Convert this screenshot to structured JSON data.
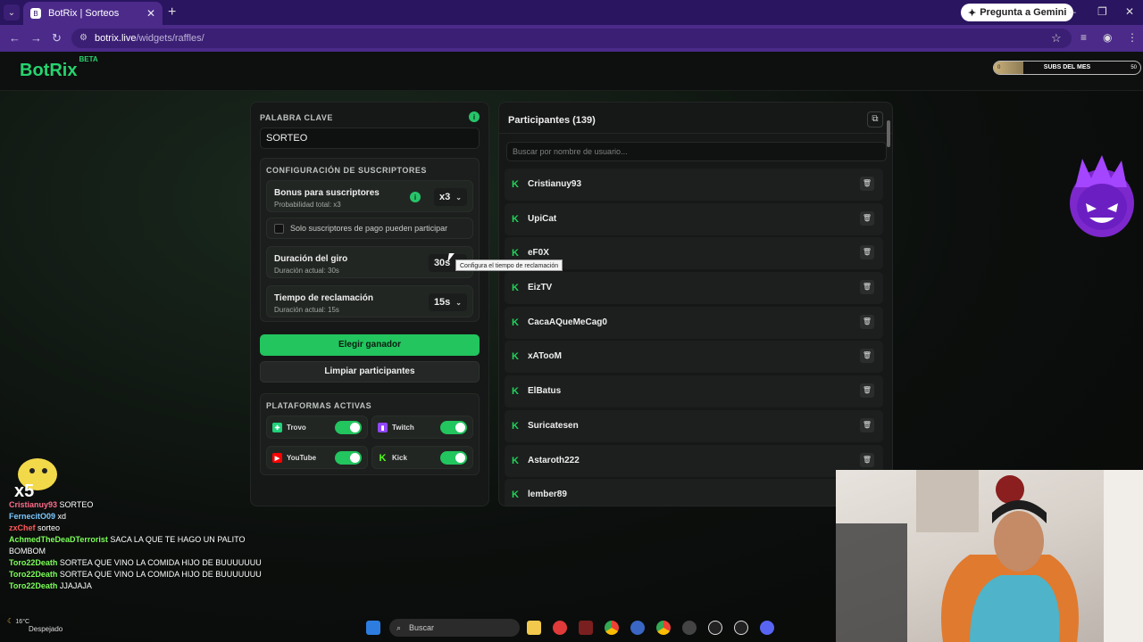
{
  "browser": {
    "tab_title": "BotRix | Sorteos",
    "url_host": "botrix.live",
    "url_path": "/widgets/raffles/",
    "gemini_label": "Pregunta a Gemini"
  },
  "header": {
    "logo": "BotRix",
    "logo_badge": "BETA",
    "subs_label": "SUBS DEL MES",
    "subs_count_left": "0",
    "subs_count_right": "50",
    "subs_progress": 0.2
  },
  "left": {
    "keyword_label": "PALABRA CLAVE",
    "keyword_value": "SORTEO",
    "subs_config_title": "CONFIGURACIÓN DE SUSCRIPTORES",
    "bonus_title": "Bonus para suscriptores",
    "bonus_sub": "Probabilidad total: x3",
    "bonus_value": "x3",
    "only_paid_label": "Solo suscriptores de pago pueden participar",
    "spin_title": "Duración del giro",
    "spin_sub": "Duración actual: 30s",
    "spin_value": "30s",
    "claim_title": "Tiempo de reclamación",
    "claim_sub": "Duración actual: 15s",
    "claim_value": "15s",
    "claim_tooltip": "Configura el tiempo de reclamación",
    "pick_winner": "Elegir ganador",
    "clear_participants": "Limpiar participantes",
    "platforms_title": "PLATAFORMAS ACTIVAS",
    "platforms": [
      {
        "name": "Trovo",
        "color": "#1fd17a",
        "enabled": true
      },
      {
        "name": "Twitch",
        "color": "#9146ff",
        "enabled": true
      },
      {
        "name": "YouTube",
        "color": "#ff0000",
        "enabled": true
      },
      {
        "name": "Kick",
        "color": "#53fc18",
        "enabled": true
      }
    ]
  },
  "right": {
    "title": "Participantes (139)",
    "search_placeholder": "Buscar por nombre de usuario...",
    "participants": [
      "Cristianuy93",
      "UpiCat",
      "eF0X",
      "EizTV",
      "CacaAQueMeCag0",
      "xATooM",
      "ElBatus",
      "Suricatesen",
      "Astaroth222",
      "lember89"
    ]
  },
  "chat": [
    {
      "user": "Cristianuy93",
      "color": "#ff6b8b",
      "msg": "SORTEO"
    },
    {
      "user": "FernecitO09",
      "color": "#7cc7ff",
      "msg": "xd"
    },
    {
      "user": "zxChef",
      "color": "#ff5a5a",
      "msg": "sorteo"
    },
    {
      "user": "AchmedTheDeaDTerrorist",
      "color": "#7dff5a",
      "msg": "SACA LA QUE TE HAGO UN PALITO BOMBOM"
    },
    {
      "user": "Toro22Death",
      "color": "#7dff5a",
      "msg": "SORTEA QUE VINO LA COMIDA HIJO DE BUUUUUUU"
    },
    {
      "user": "Toro22Death",
      "color": "#7dff5a",
      "msg": "SORTEA QUE VINO LA COMIDA HIJO DE BUUUUUUU"
    },
    {
      "user": "Toro22Death",
      "color": "#7dff5a",
      "msg": "JJAJAJA"
    }
  ],
  "chat_badge": "x5",
  "taskbar": {
    "search": "Buscar",
    "weather": "Despejado",
    "temperature": "16°C"
  }
}
